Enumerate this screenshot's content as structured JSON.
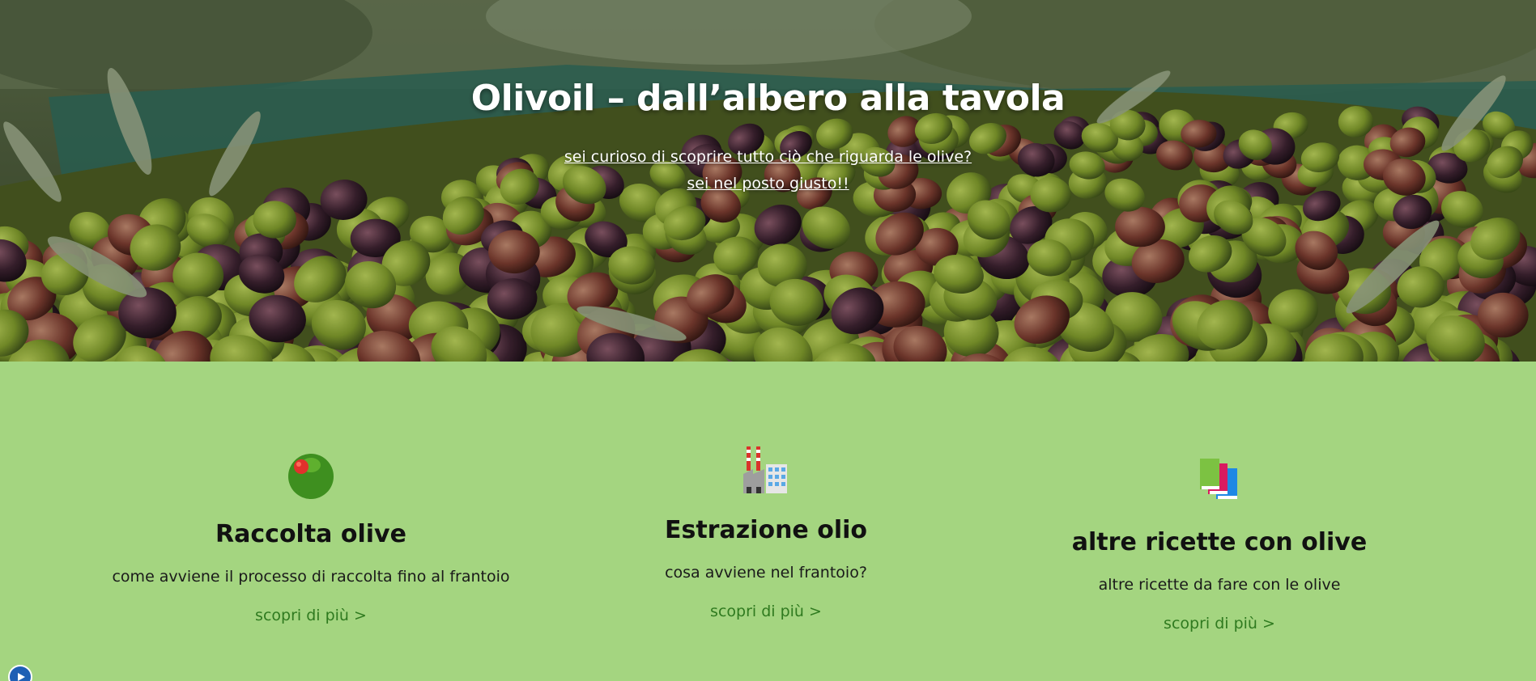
{
  "hero": {
    "title": "Olivoil – dall’albero alla tavola",
    "subtitle_line1": "sei curioso di scoprire tutto ciò che riguarda le olive?",
    "subtitle_line2": "sei nel posto giusto!!"
  },
  "features": [
    {
      "icon": "olive-icon",
      "title": "Raccolta olive",
      "description": "come avviene il processo di raccolta fino al frantoio",
      "link": "scopri di più >"
    },
    {
      "icon": "factory-icon",
      "title": "Estrazione olio",
      "description": "cosa avviene nel frantoio?",
      "link": "scopri di più >"
    },
    {
      "icon": "books-icon",
      "title": "altre ricette con olive",
      "description": "altre ricette da fare con le olive",
      "link": "scopri di più >"
    }
  ],
  "colors": {
    "section_background": "#a4d580",
    "link": "#2f7a1f",
    "heading": "#111111",
    "hero_text": "#ffffff"
  },
  "accessibility_widget_icon": "play-circle-icon"
}
